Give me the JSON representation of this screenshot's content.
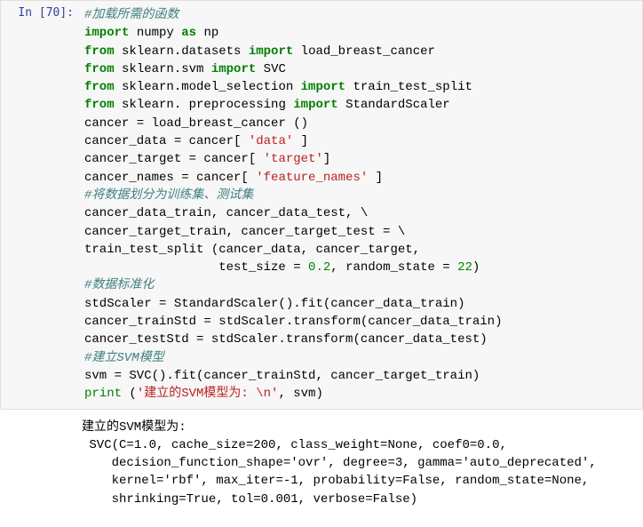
{
  "prompt": {
    "label": "In",
    "num": "70"
  },
  "code": {
    "c1": "#加载所需的函数",
    "l2_import": "import",
    "l2_np": "numpy",
    "l2_as": "as",
    "l2_alias": "np",
    "l3_from": "from",
    "l3_mod": "sklearn.datasets",
    "l3_import": "import",
    "l3_name": "load_breast_cancer",
    "l4_from": "from",
    "l4_mod": "sklearn.svm",
    "l4_import": "import",
    "l4_name": "SVC",
    "l5_from": "from",
    "l5_mod": "sklearn.model_selection",
    "l5_import": "import",
    "l5_name": "train_test_split",
    "l6_from": "from",
    "l6_mod": "sklearn. preprocessing",
    "l6_import": "import",
    "l6_name": "StandardScaler",
    "l7": "cancer = load_breast_cancer ()",
    "l8a": "cancer_data = cancer[ ",
    "l8s": "'data'",
    "l8b": " ]",
    "l9a": "cancer_target = cancer[ ",
    "l9s": "'target'",
    "l9b": "]",
    "l10a": "cancer_names = cancer[ ",
    "l10s": "'feature_names'",
    "l10b": " ]",
    "c11": "#将数据划分为训练集、测试集",
    "l12": "cancer_data_train, cancer_data_test, \\",
    "l13": "cancer_target_train, cancer_target_test = \\",
    "l14": "train_test_split (cancer_data, cancer_target,",
    "l15a": "                  test_size = ",
    "l15n1": "0.2",
    "l15b": ", random_state = ",
    "l15n2": "22",
    "l15c": ")",
    "c16": "#数据标准化",
    "l17": "stdScaler = StandardScaler().fit(cancer_data_train)",
    "l18": "cancer_trainStd = stdScaler.transform(cancer_data_train)",
    "l19": "cancer_testStd = stdScaler.transform(cancer_data_test)",
    "c20": "#建立SVM模型",
    "l21": "svm = SVC().fit(cancer_trainStd, cancer_target_train)",
    "l22_print": "print",
    "l22a": " (",
    "l22s": "'建立的SVM模型为: \\n'",
    "l22b": ", svm)"
  },
  "output": {
    "line1": "建立的SVM模型为:",
    "line2": " SVC(C=1.0, cache_size=200, class_weight=None, coef0=0.0,",
    "line3": "    decision_function_shape='ovr', degree=3, gamma='auto_deprecated',",
    "line4": "    kernel='rbf', max_iter=-1, probability=False, random_state=None,",
    "line5": "    shrinking=True, tol=0.001, verbose=False)"
  }
}
